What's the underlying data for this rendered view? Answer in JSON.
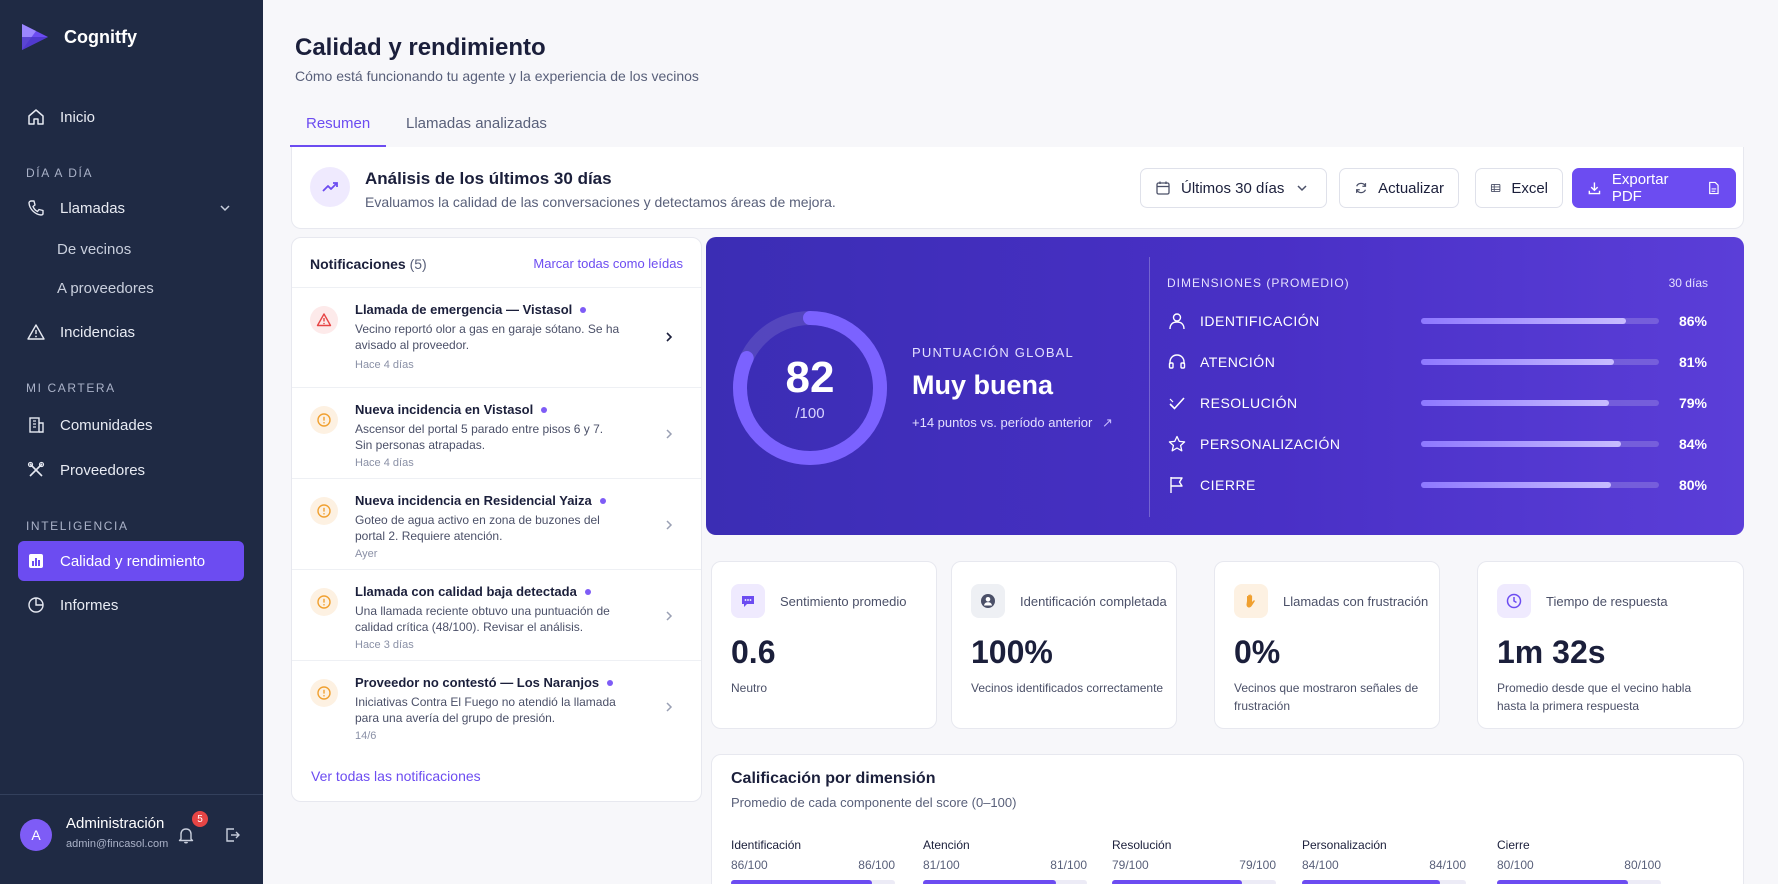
{
  "app": {
    "name": "Cognitfy"
  },
  "sidebar": {
    "inicio": "Inicio",
    "section_dia": "DÍA A DÍA",
    "llamadas": "Llamadas",
    "de_vecinos": "De vecinos",
    "a_proveedores": "A proveedores",
    "incidencias": "Incidencias",
    "section_cartera": "MI CARTERA",
    "comunidades": "Comunidades",
    "proveedores": "Proveedores",
    "section_inteligencia": "INTELIGENCIA",
    "calidad": "Calidad y rendimiento",
    "informes": "Informes",
    "user": {
      "initial": "A",
      "name": "Administración",
      "email": "admin@fincasol.com",
      "notifications_badge": "5"
    }
  },
  "header": {
    "title": "Calidad y rendimiento",
    "subtitle": "Cómo está funcionando tu agente y la experiencia de los vecinos"
  },
  "tabs": [
    "Resumen",
    "Llamadas analizadas"
  ],
  "toolbar": {
    "title": "Análisis de los últimos 30 días",
    "subtitle": "Evaluamos la calidad de las conversaciones y detectamos áreas de mejora.",
    "period": "Últimos 30 días",
    "refresh": "Actualizar",
    "excel": "Excel",
    "export": "Exportar PDF"
  },
  "notifications": {
    "title": "Notificaciones",
    "count": "(5)",
    "mark_all": "Marcar todas como leídas",
    "see_all": "Ver todas las notificaciones",
    "items": [
      {
        "title": "Llamada de emergencia — Vistasol",
        "body": "Vecino reportó olor a gas en garaje sótano. Se ha avisado al proveedor.",
        "time": "Hace 4 días",
        "type": "emergency"
      },
      {
        "title": "Nueva incidencia en Vistasol",
        "body": "Ascensor del portal 5 parado entre pisos 6 y 7. Sin personas atrapadas.",
        "time": "Hace 4 días",
        "type": "warning"
      },
      {
        "title": "Nueva incidencia en Residencial Yaiza",
        "body": "Goteo de agua activo en zona de buzones del portal 2. Requiere atención.",
        "time": "Ayer",
        "type": "warning"
      },
      {
        "title": "Llamada con calidad baja detectada",
        "body": "Una llamada reciente obtuvo una puntuación de calidad crítica (48/100). Revisar el análisis.",
        "time": "Hace 3 días",
        "type": "warning"
      },
      {
        "title": "Proveedor no contestó — Los Naranjos",
        "body": "Iniciativas Contra El Fuego no atendió la llamada para una avería del grupo de presión.",
        "time": "14/6",
        "type": "warning"
      }
    ]
  },
  "score": {
    "value": "82",
    "value_num": 82,
    "max": "/100",
    "label": "PUNTUACIÓN GLOBAL",
    "rating": "Muy buena",
    "delta": "+14 puntos vs. período anterior",
    "dim_header": "DIMENSIONES (PROMEDIO)",
    "dim_period": "30 días",
    "dimensions": [
      {
        "name": "IDENTIFICACIÓN",
        "pct": "86%",
        "value": 86
      },
      {
        "name": "ATENCIÓN",
        "pct": "81%",
        "value": 81
      },
      {
        "name": "RESOLUCIÓN",
        "pct": "79%",
        "value": 79
      },
      {
        "name": "PERSONALIZACIÓN",
        "pct": "84%",
        "value": 84
      },
      {
        "name": "CIERRE",
        "pct": "80%",
        "value": 80
      }
    ]
  },
  "kpis": [
    {
      "label": "Sentimiento promedio",
      "value": "0.6",
      "desc": "Neutro",
      "icon": "chat-icon",
      "color": "#6c4cf1"
    },
    {
      "label": "Identificación completada",
      "value": "100%",
      "desc": "Vecinos identificados correctamente",
      "icon": "user-icon",
      "color": "#4b5068"
    },
    {
      "label": "Llamadas con frustración",
      "value": "0%",
      "desc": "Vecinos que mostraron señales de frustración",
      "icon": "hand-icon",
      "color": "#f0a030"
    },
    {
      "label": "Tiempo de respuesta",
      "value": "1m 32s",
      "desc": "Promedio desde que el vecino habla hasta la primera respuesta",
      "icon": "clock-icon",
      "color": "#6c4cf1"
    }
  ],
  "ratings": {
    "title": "Calificación por dimensión",
    "subtitle": "Promedio de cada componente del score (0–100)",
    "items": [
      {
        "name": "Identificación",
        "left": "86/100",
        "right": "86/100",
        "value": 86
      },
      {
        "name": "Atención",
        "left": "81/100",
        "right": "81/100",
        "value": 81
      },
      {
        "name": "Resolución",
        "left": "79/100",
        "right": "79/100",
        "value": 79
      },
      {
        "name": "Personalización",
        "left": "84/100",
        "right": "84/100",
        "value": 84
      },
      {
        "name": "Cierre",
        "left": "80/100",
        "right": "80/100",
        "value": 80
      }
    ]
  },
  "colors": {
    "accent": "#6c4cf1",
    "sidebar": "#1f2a44",
    "panel": "#4930c6",
    "danger": "#e64545",
    "warning": "#f0a030"
  }
}
